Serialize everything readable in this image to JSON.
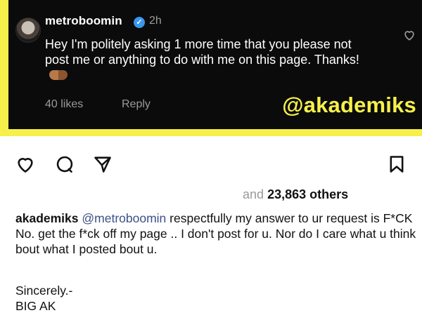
{
  "comment": {
    "username": "metroboomin",
    "time": "2h",
    "text": "Hey I'm politely asking 1 more time that you please not post me or anything to do with me on this page. Thanks!",
    "likes": "40 likes",
    "reply": "Reply",
    "emoji": "handshake"
  },
  "watermark": "@akademiks",
  "post": {
    "likes_prefix": "and",
    "likes_count": "23,863 others",
    "caption_user": "akademiks",
    "caption_mention": "@metroboomin",
    "caption_text": "respectfully my answer to ur request is F*CK No. get the f*ck off my page .. I don't post for u. Nor do I care what u think bout what I posted bout u.",
    "signoff_line1": "Sincerely.-",
    "signoff_line2": "BIG AK"
  },
  "colors": {
    "accent_yellow": "#f6f04a",
    "verified_blue": "#3897f0",
    "mention": "#3c4f86"
  },
  "icons": [
    "heart-icon",
    "comment-icon",
    "share-icon",
    "bookmark-icon",
    "verified-icon"
  ]
}
